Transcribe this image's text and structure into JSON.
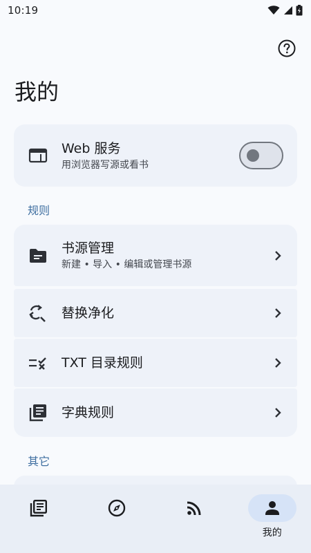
{
  "status_bar": {
    "time": "10:19"
  },
  "header": {
    "title": "我的",
    "help_icon": "help-circle-icon"
  },
  "web_service": {
    "title": "Web 服务",
    "subtitle": "用浏览器写源或看书",
    "toggle_on": false
  },
  "sections": {
    "rules_label": "规则",
    "other_label": "其它"
  },
  "rules": [
    {
      "title": "书源管理",
      "subtitle": "新建 • 导入 • 编辑或管理书源",
      "icon": "folder-icon"
    },
    {
      "title": "替换净化",
      "icon": "find-replace-icon"
    },
    {
      "title": "TXT 目录规则",
      "icon": "rule-icon"
    },
    {
      "title": "字典规则",
      "icon": "library-books-icon"
    }
  ],
  "bottom_nav": {
    "items": [
      {
        "icon": "bookshelf-icon",
        "label": ""
      },
      {
        "icon": "compass-icon",
        "label": ""
      },
      {
        "icon": "rss-icon",
        "label": ""
      },
      {
        "icon": "person-icon",
        "label": "我的",
        "active": true
      }
    ]
  },
  "colors": {
    "accent": "#3e6ea0",
    "card": "#eef2f9",
    "nav_bg": "#e9eef6",
    "active_pill": "#d6e3f7"
  }
}
